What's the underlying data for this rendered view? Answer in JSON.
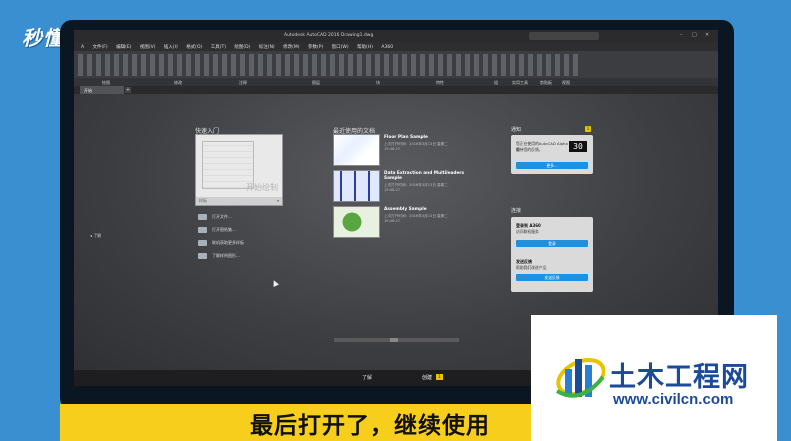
{
  "watermark": {
    "brand": "秒懂视频"
  },
  "app": {
    "title": "Autodesk AutoCAD 2016  Drawing1.dwg",
    "menu": [
      "A",
      "文件(F)",
      "编辑(E)",
      "视图(V)",
      "插入(I)",
      "格式(O)",
      "工具(T)",
      "绘图(D)",
      "标注(N)",
      "修改(M)",
      "参数(P)",
      "窗口(W)",
      "帮助(H)",
      "A360"
    ],
    "ribbon_panels": [
      "绘图",
      "修改",
      "注释",
      "图层",
      "块",
      "特性",
      "组",
      "实用工具",
      "剪贴板",
      "视图"
    ],
    "tabs": {
      "start": "开始",
      "plus": "+"
    }
  },
  "start_page": {
    "learn_left": "了解",
    "quick_start": {
      "title": "快速入门",
      "card_label": "开始绘制",
      "card_bar": "样板",
      "items": [
        "打开文件...",
        "打开图纸集...",
        "联机获取更多样板",
        "了解样例图形..."
      ]
    },
    "recent": {
      "title": "最近使用的文档",
      "items": [
        {
          "title": "Floor Plan Sample",
          "line1": "上次打开时间：2016年3月13日 星期二",
          "line2": "19:48:27"
        },
        {
          "title": "Data Extraction and Multileaders Sample",
          "line1": "上次打开时间：2016年3月13日 星期二",
          "line2": "19:48:27"
        },
        {
          "title": "Assembly Sample",
          "line1": "上次打开时间：2016年3月13日 星期二",
          "line2": "19:48:27"
        }
      ]
    },
    "notifications": {
      "title": "通知",
      "count": "1",
      "text": "您正在使用的AutoCAD Alpha版",
      "text2": "期待您的反馈。",
      "counter": "30",
      "button": "更多..."
    },
    "connect": {
      "title": "连接",
      "a360_title": "登录到 A360",
      "a360_desc": "访问联机服务",
      "a360_button": "登录",
      "feedback_title": "发送反馈",
      "feedback_desc": "帮助我们改进产品",
      "feedback_button": "发送反馈"
    }
  },
  "bottom_bar": {
    "learn": "了解",
    "create": "创建",
    "create_badge": "1"
  },
  "subtitle": "最后打开了，继续使用",
  "civil_logo": {
    "main": "土木工程网",
    "url": "www.civilcn.com"
  },
  "colors": {
    "background": "#3a8fd0",
    "subtitle_bar": "#f8ce1c",
    "accent_button": "#1f8fe0",
    "logo_blue": "#1a4a98"
  }
}
